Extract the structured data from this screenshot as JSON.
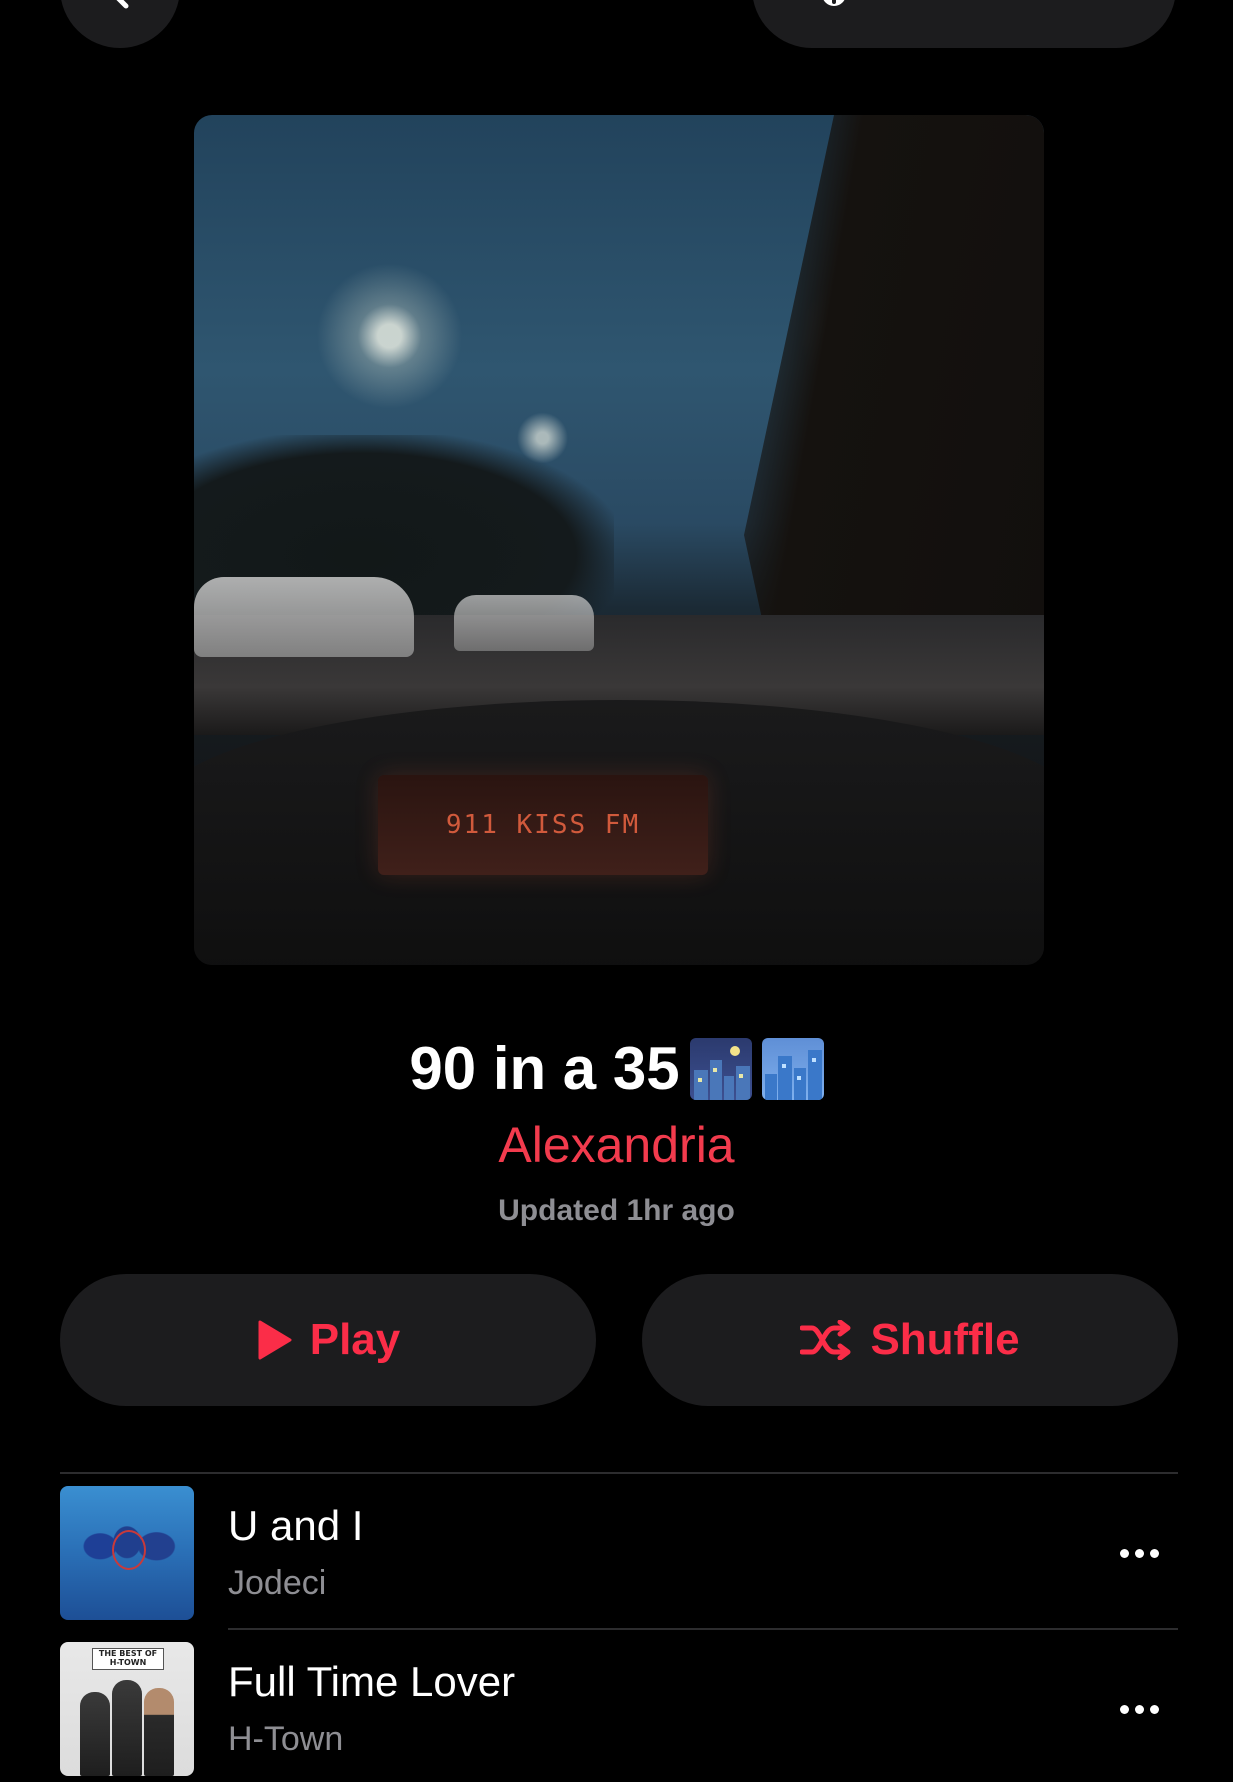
{
  "header": {
    "back_icon": "chevron-left-icon",
    "actions": [
      {
        "icon": "add-person-icon"
      },
      {
        "icon": "download-icon"
      }
    ]
  },
  "playlist": {
    "title": "90 in a 35",
    "title_emoji": [
      "night-city-emoji",
      "cityscape-emoji"
    ],
    "owner": "Alexandria",
    "updated": "Updated 1hr ago",
    "artwork": {
      "radio_display": "911  KISS FM"
    }
  },
  "buttons": {
    "play_label": "Play",
    "shuffle_label": "Shuffle"
  },
  "tracks": [
    {
      "title": "U and I",
      "artist": "Jodeci",
      "art_icon": "album-art"
    },
    {
      "title": "Full Time Lover",
      "artist": "H-Town",
      "art_icon": "album-art",
      "art_text": "THE BEST OF H-TOWN"
    }
  ],
  "colors": {
    "accent": "#fb2d48",
    "background": "#000000",
    "button_bg": "#1c1c1e",
    "secondary_text": "#8e8e93"
  }
}
